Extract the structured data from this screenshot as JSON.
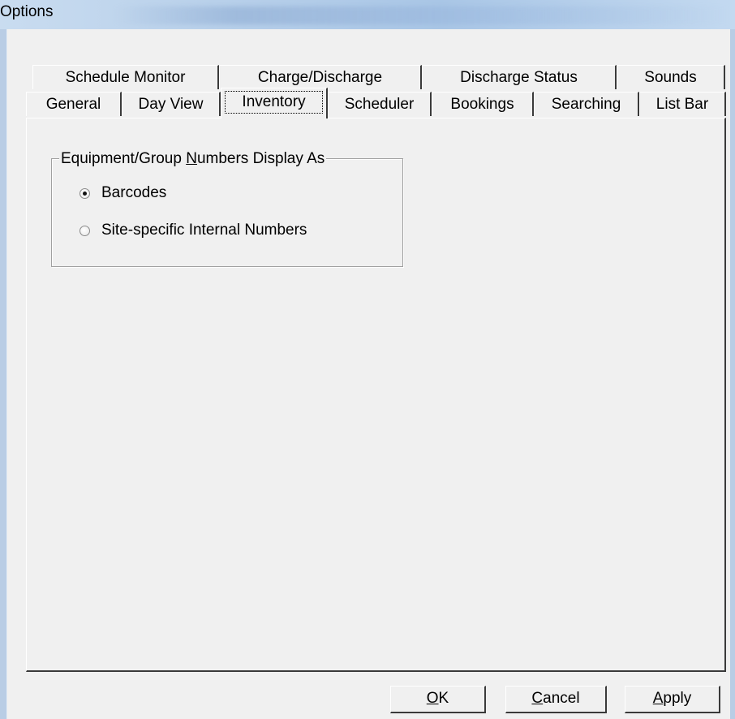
{
  "window": {
    "title": "Options"
  },
  "tabs": {
    "row1": [
      {
        "label": "Schedule Monitor"
      },
      {
        "label": "Charge/Discharge"
      },
      {
        "label": "Discharge Status"
      },
      {
        "label": "Sounds"
      }
    ],
    "row2": [
      {
        "label": "General"
      },
      {
        "label": "Day View"
      },
      {
        "label": "Inventory",
        "selected": true
      },
      {
        "label": "Scheduler"
      },
      {
        "label": "Bookings"
      },
      {
        "label": "Searching"
      },
      {
        "label": "List Bar"
      }
    ]
  },
  "group": {
    "legend_prefix": "Equipment/Group ",
    "legend_mnemonic": "N",
    "legend_suffix": "umbers Display As",
    "options": [
      {
        "label": "Barcodes",
        "checked": true
      },
      {
        "label": "Site-specific Internal Numbers",
        "checked": false
      }
    ]
  },
  "buttons": {
    "ok": {
      "mnemonic": "O",
      "rest": "K"
    },
    "cancel": {
      "mnemonic": "C",
      "rest": "ancel"
    },
    "apply": {
      "mnemonic": "A",
      "rest": "pply"
    }
  },
  "colors": {
    "face": "#f0f0f0",
    "title_bar": "#b8d0ea",
    "shadow": "#3a3a3a",
    "highlight": "#ffffff"
  }
}
